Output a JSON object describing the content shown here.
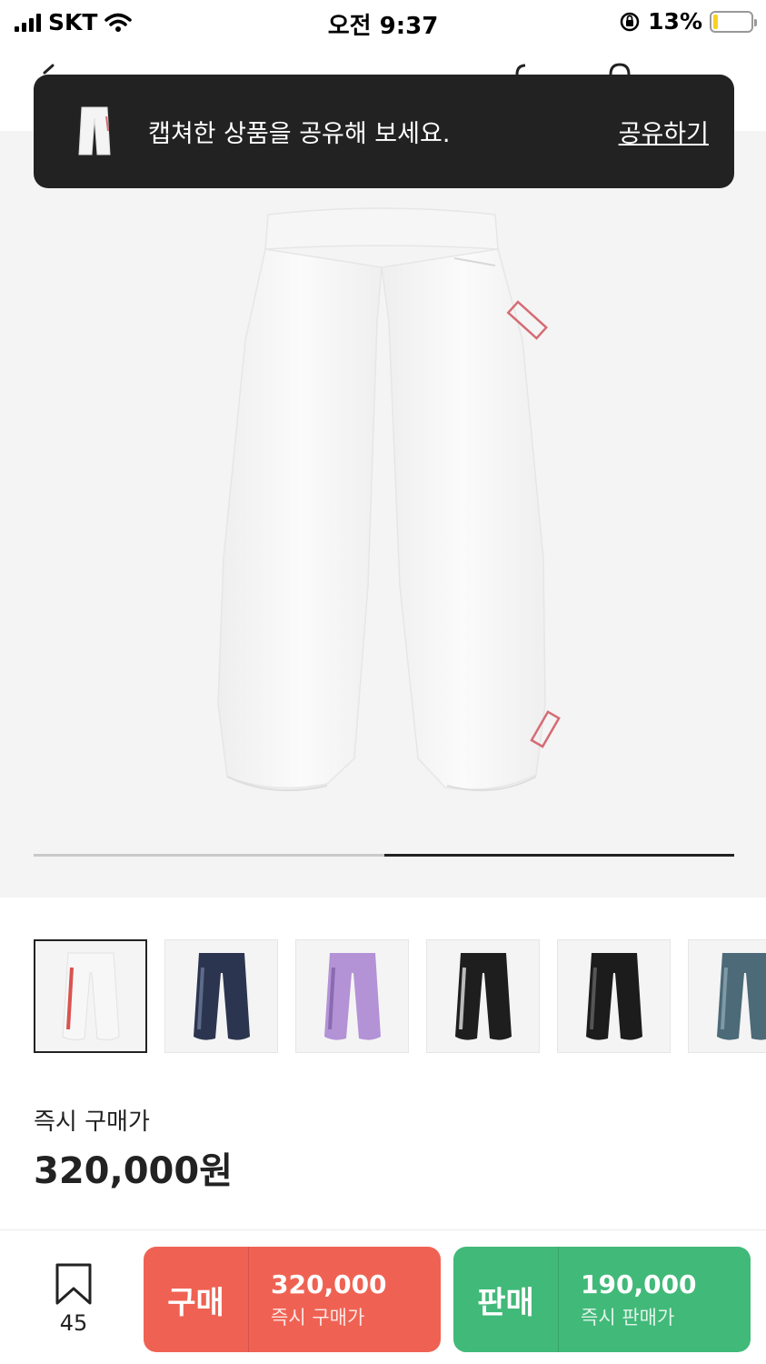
{
  "status_bar": {
    "carrier": "SKT",
    "time": "오전 9:37",
    "battery_percent": "13%",
    "battery_level": 0.13,
    "battery_color": "#f7d21e"
  },
  "toast": {
    "message": "캡쳐한 상품을 공유해 보세요.",
    "action": "공유하기"
  },
  "hero": {
    "background": "#f4f4f4",
    "carousel_progress": 0.5
  },
  "thumbnails": [
    {
      "color": "#f7f7f7",
      "accent": "#d9534f",
      "selected": true
    },
    {
      "color": "#2c3550",
      "accent": "#5d6a8a",
      "selected": false
    },
    {
      "color": "#b392d6",
      "accent": "#8a6ab0",
      "selected": false
    },
    {
      "color": "#1e1e1e",
      "accent": "#bbbbbb",
      "selected": false
    },
    {
      "color": "#1c1c1c",
      "accent": "#555555",
      "selected": false
    },
    {
      "color": "#4c6a78",
      "accent": "#7f99a6",
      "selected": false
    }
  ],
  "price": {
    "label": "즉시 구매가",
    "value": "320,000원"
  },
  "bottom_bar": {
    "bookmark_count": "45",
    "buy": {
      "title": "구매",
      "price": "320,000",
      "sub": "즉시 구매가",
      "color": "#ef6253"
    },
    "sell": {
      "title": "판매",
      "price": "190,000",
      "sub": "즉시 판매가",
      "color": "#41b979"
    }
  }
}
